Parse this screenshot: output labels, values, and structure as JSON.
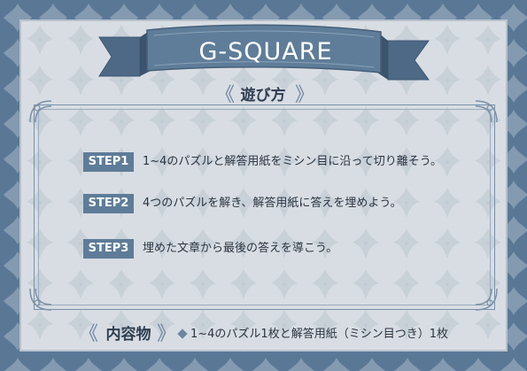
{
  "banner": {
    "title": "G-SQUARE"
  },
  "how_to_play": {
    "title": "遊び方",
    "steps": [
      {
        "label": "STEP1",
        "text": "1~4のパズルと解答用紙をミシン目に沿って切り離そう。"
      },
      {
        "label": "STEP2",
        "text": "4つのパズルを解き、解答用紙に答えを埋めよう。"
      },
      {
        "label": "STEP3",
        "text": "埋めた文章から最後の答えを導こう。"
      }
    ]
  },
  "contents": {
    "title": "内容物",
    "text": "1~4のパズル1枚と解答用紙（ミシン目つき）1枚"
  },
  "colors": {
    "border_blue": "#5a7896",
    "panel_gray": "#d8dde3",
    "badge_blue": "#5e7c98",
    "banner_blue": "#5f7d99"
  }
}
